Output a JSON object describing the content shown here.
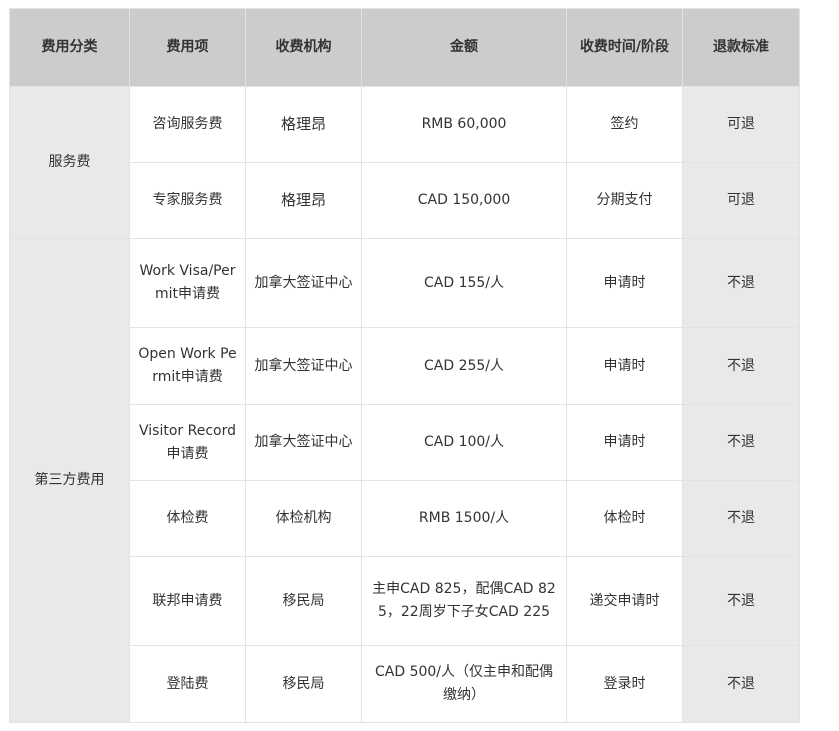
{
  "table": {
    "headers": [
      "费用分类",
      "费用项",
      "收费机构",
      "金额",
      "收费时间/阶段",
      "退款标准"
    ],
    "groups": [
      {
        "category": "服务费",
        "rows": [
          {
            "item": "咨询服务费",
            "agency": "格理昂",
            "amount": "RMB 60,000",
            "timing": "签约",
            "refund": "可退"
          },
          {
            "item": "专家服务费",
            "agency": "格理昂",
            "amount": "CAD 150,000",
            "timing": "分期支付",
            "refund": "可退"
          }
        ]
      },
      {
        "category": "第三方费用",
        "rows": [
          {
            "item": "Work Visa/Permit申请费",
            "agency": "加拿大签证中心",
            "amount": "CAD 155/人",
            "timing": "申请时",
            "refund": "不退"
          },
          {
            "item": "Open Work Permit申请费",
            "agency": "加拿大签证中心",
            "amount": "CAD 255/人",
            "timing": "申请时",
            "refund": "不退"
          },
          {
            "item": "Visitor Record 申请费",
            "agency": "加拿大签证中心",
            "amount": "CAD 100/人",
            "timing": "申请时",
            "refund": "不退"
          },
          {
            "item": "体检费",
            "agency": "体检机构",
            "amount": "RMB 1500/人",
            "timing": "体检时",
            "refund": "不退"
          },
          {
            "item": "联邦申请费",
            "agency": "移民局",
            "amount": "主申CAD 825，配偶CAD 825，22周岁下子女CAD 225",
            "timing": "递交申请时",
            "refund": "不退"
          },
          {
            "item": "登陆费",
            "agency": "移民局",
            "amount": "CAD 500/人（仅主申和配偶缴纳）",
            "timing": "登录时",
            "refund": "不退"
          }
        ]
      }
    ]
  }
}
